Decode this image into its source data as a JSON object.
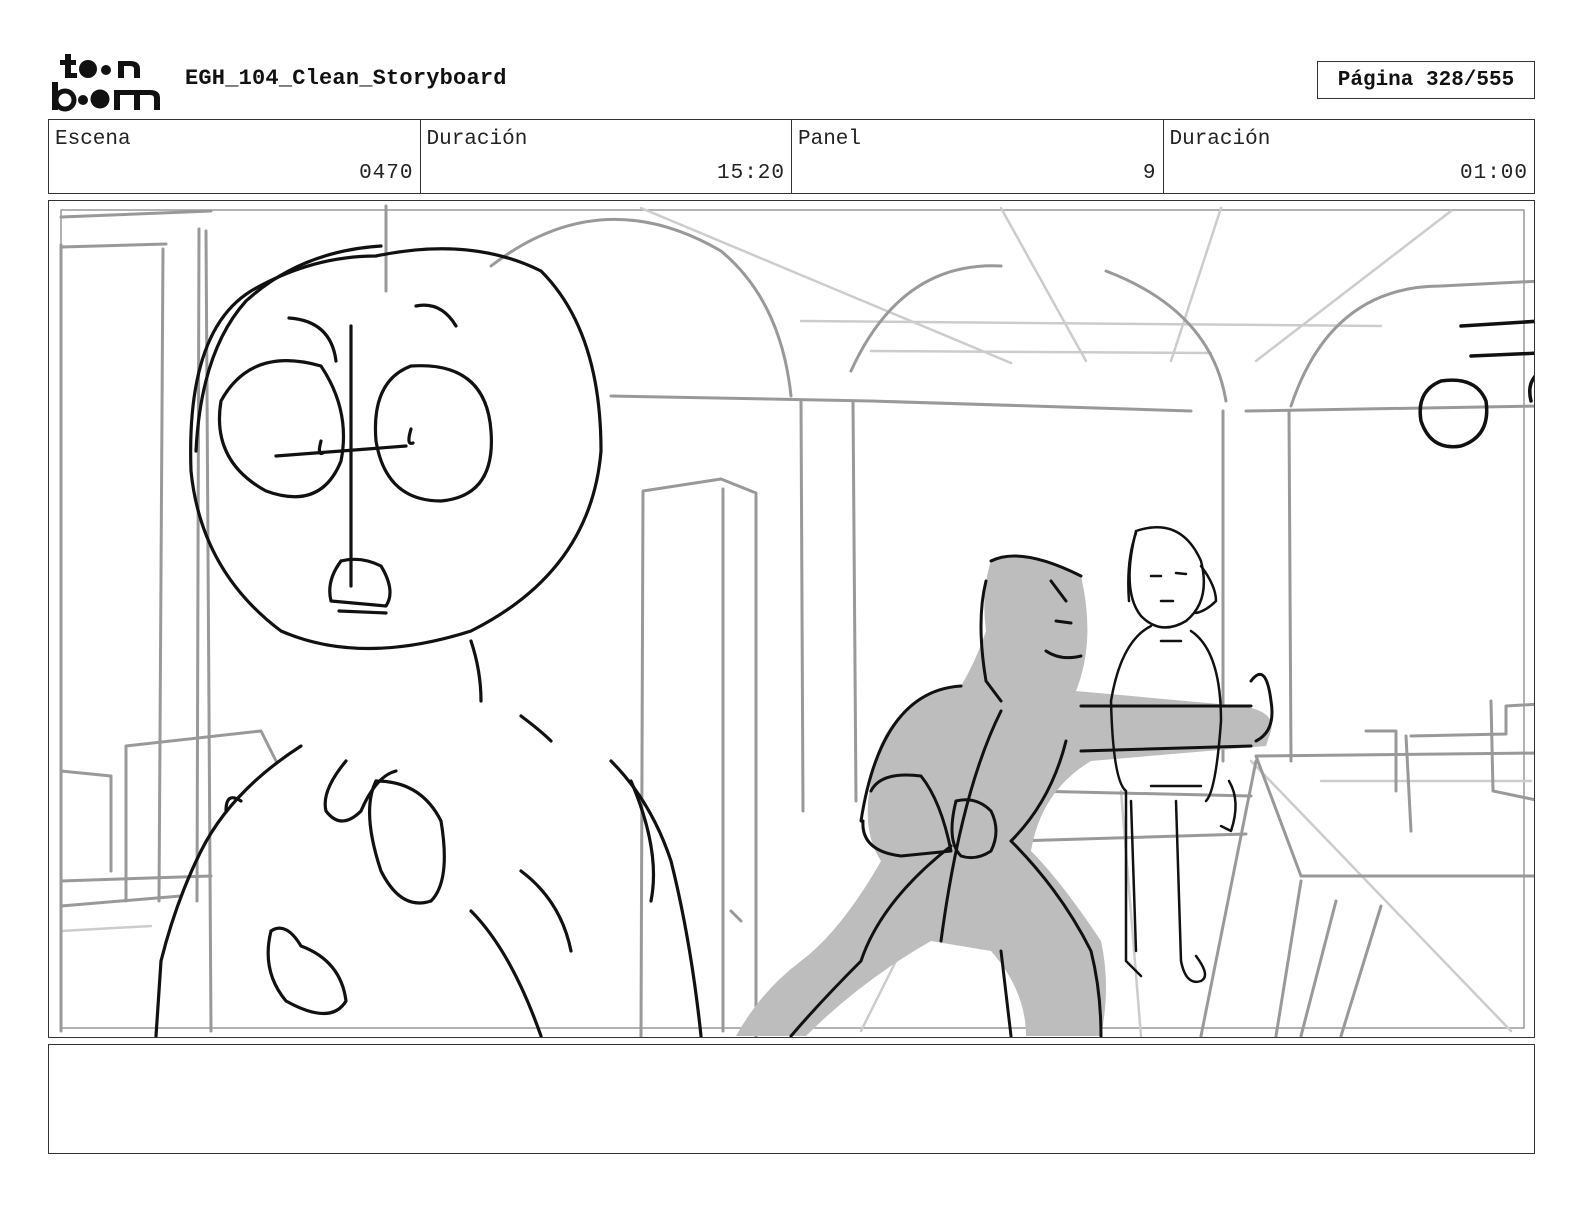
{
  "header": {
    "logo_text": "toon boom",
    "title": "EGH_104_Clean_Storyboard",
    "page_label": "Página",
    "page_value": "328/555"
  },
  "info": {
    "scene_label": "Escena",
    "scene_value": "0470",
    "scene_duration_label": "Duración",
    "scene_duration_value": "15:20",
    "panel_label": "Panel",
    "panel_value": "9",
    "panel_duration_label": "Duración",
    "panel_duration_value": "01:00"
  },
  "notes": {
    "text": ""
  }
}
